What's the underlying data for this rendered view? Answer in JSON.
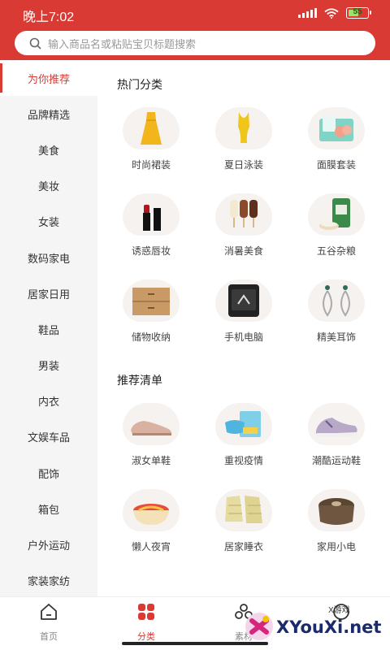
{
  "status_bar": {
    "time": "晚上7:02",
    "battery": "55",
    "battery_level": 0.55
  },
  "search": {
    "placeholder": "输入商品名或粘贴宝贝标题搜索"
  },
  "sidebar": {
    "items": [
      {
        "label": "为你推荐",
        "active": true
      },
      {
        "label": "品牌精选"
      },
      {
        "label": "美食"
      },
      {
        "label": "美妆"
      },
      {
        "label": "女装"
      },
      {
        "label": "数码家电"
      },
      {
        "label": "居家日用"
      },
      {
        "label": "鞋品"
      },
      {
        "label": "男装"
      },
      {
        "label": "内衣"
      },
      {
        "label": "文娱车品"
      },
      {
        "label": "配饰"
      },
      {
        "label": "箱包"
      },
      {
        "label": "户外运动"
      },
      {
        "label": "家装家纺"
      }
    ]
  },
  "sections": [
    {
      "title": "热门分类",
      "items": [
        {
          "label": "时尚裙装",
          "icon": "dress-icon"
        },
        {
          "label": "夏日泳装",
          "icon": "swimsuit-icon"
        },
        {
          "label": "面膜套装",
          "icon": "facemask-icon"
        },
        {
          "label": "诱惑唇妆",
          "icon": "lipstick-icon"
        },
        {
          "label": "消暑美食",
          "icon": "popsicle-icon"
        },
        {
          "label": "五谷杂粮",
          "icon": "rice-bag-icon"
        },
        {
          "label": "储物收纳",
          "icon": "drawer-icon"
        },
        {
          "label": "手机电脑",
          "icon": "phone-icon"
        },
        {
          "label": "精美耳饰",
          "icon": "earring-icon"
        }
      ]
    },
    {
      "title": "推荐清单",
      "items": [
        {
          "label": "淑女单鞋",
          "icon": "loafer-icon"
        },
        {
          "label": "重视疫情",
          "icon": "mask-box-icon"
        },
        {
          "label": "潮酷运动鞋",
          "icon": "sneaker-icon"
        },
        {
          "label": "懒人夜宵",
          "icon": "noodle-icon"
        },
        {
          "label": "居家睡衣",
          "icon": "pajamas-icon"
        },
        {
          "label": "家用小电",
          "icon": "rice-cooker-icon"
        }
      ]
    }
  ],
  "bottom_nav": [
    {
      "label": "首页",
      "icon": "home-icon"
    },
    {
      "label": "分类",
      "icon": "category-icon",
      "active": true
    },
    {
      "label": "素材",
      "icon": "material-icon"
    },
    {
      "label": "",
      "icon": "profile-icon"
    }
  ],
  "watermark": {
    "badge": "X游戏",
    "text": "XYouXi.net"
  },
  "colors": {
    "brand": "#d93a33",
    "sidebar_bg": "#f5f5f5"
  }
}
